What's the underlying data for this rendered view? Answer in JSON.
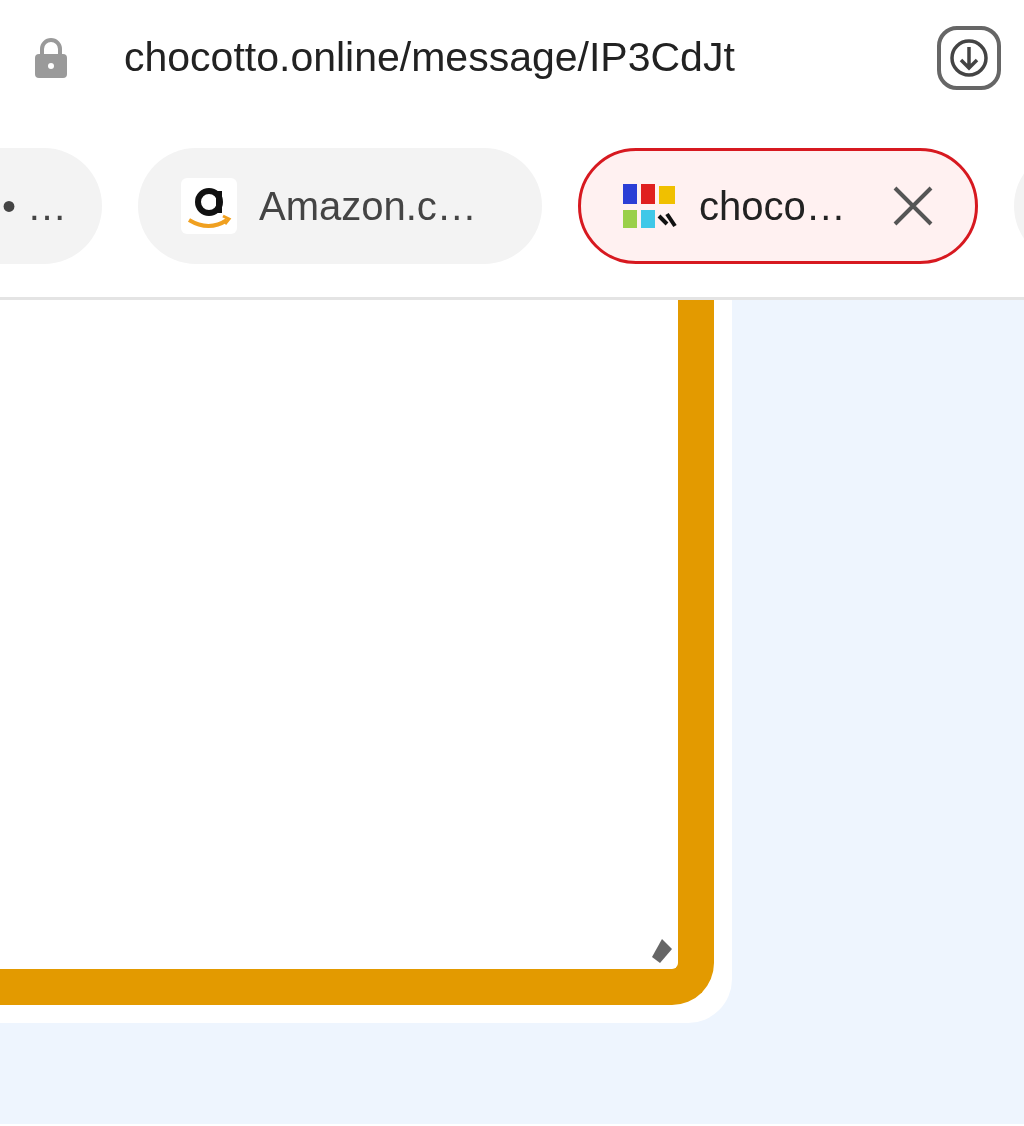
{
  "address_bar": {
    "url": "chocotto.online/message/IP3CdJt"
  },
  "tabs": [
    {
      "label": "• …",
      "selected": false,
      "kind": "plain",
      "closable": false
    },
    {
      "label": "Amazon.c…",
      "selected": false,
      "kind": "amazon",
      "closable": false
    },
    {
      "label": "choco…",
      "selected": true,
      "kind": "choco",
      "closable": true
    },
    {
      "selected": false,
      "kind": "plain"
    }
  ],
  "page": {
    "text_area": {
      "focused": true
    }
  }
}
